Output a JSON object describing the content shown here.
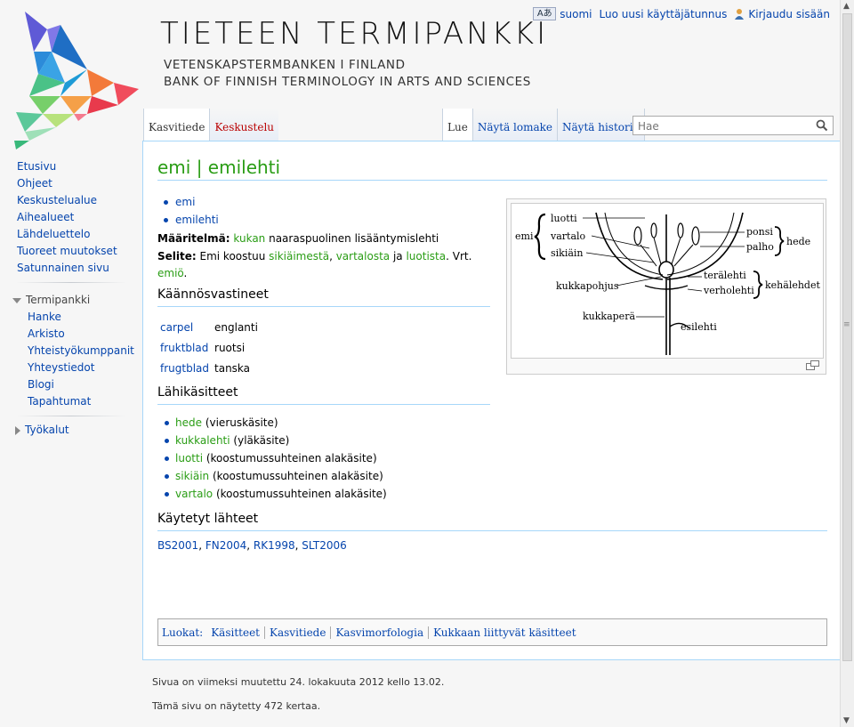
{
  "site": {
    "title": "TIETEEN TERMIPANKKI",
    "subtitle_sv": "VETENSKAPSTERMBANKEN I FINLAND",
    "subtitle_en": "BANK OF FINNISH TERMINOLOGY IN ARTS AND SCIENCES"
  },
  "personal": {
    "language": "suomi",
    "create_account": "Luo uusi käyttäjätunnus",
    "login": "Kirjaudu sisään"
  },
  "tabs": {
    "namespace": "Kasvitiede",
    "talk": "Keskustelu",
    "read": "Lue",
    "form": "Näytä lomake",
    "history": "Näytä historia"
  },
  "search": {
    "placeholder": "Hae"
  },
  "sidebar": {
    "nav": [
      "Etusivu",
      "Ohjeet",
      "Keskustelualue",
      "Aihealueet",
      "Lähdeluettelo",
      "Tuoreet muutokset",
      "Satunnainen sivu"
    ],
    "portal_title": "Termipankki",
    "portal": [
      "Hanke",
      "Arkisto",
      "Yhteistyökumppanit",
      "Yhteystiedot",
      "Blogi",
      "Tapahtumat"
    ],
    "tools": "Työkalut"
  },
  "page": {
    "heading": "emi | emilehti",
    "terms": [
      "emi",
      "emilehti"
    ],
    "def_label": "Määritelmä:",
    "def_link": "kukan",
    "def_text": " naaraspuolinen lisääntymislehti",
    "note_label": "Selite:",
    "note_t1": " Emi koostuu ",
    "note_l1": "sikiäimestä",
    "note_t2": ", ",
    "note_l2": "vartalosta",
    "note_t3": " ja ",
    "note_l3": "luotista",
    "note_t4": ". Vrt. ",
    "note_l4": "emiö",
    "note_t5": ".",
    "translations_heading": "Käännösvastineet",
    "translations": [
      {
        "term": "carpel",
        "lang": "englanti"
      },
      {
        "term": "fruktblad",
        "lang": "ruotsi"
      },
      {
        "term": "frugtblad",
        "lang": "tanska"
      }
    ],
    "related_heading": "Lähikäsitteet",
    "related": [
      {
        "term": "hede",
        "rel": " (vieruskäsite)"
      },
      {
        "term": "kukkalehti",
        "rel": " (yläkäsite)"
      },
      {
        "term": "luotti",
        "rel": " (koostumussuhteinen alakäsite)"
      },
      {
        "term": "sikiäin",
        "rel": " (koostumussuhteinen alakäsite)"
      },
      {
        "term": "vartalo",
        "rel": " (koostumussuhteinen alakäsite)"
      }
    ],
    "sources_heading": "Käytetyt lähteet",
    "sources": [
      "BS2001",
      "FN2004",
      "RK1998",
      "SLT2006"
    ],
    "figure_labels": {
      "emi": "emi",
      "luotti": "luotti",
      "vartalo": "vartalo",
      "sikiain": "sikiäin",
      "ponsi": "ponsi",
      "palho": "palho",
      "hede": "hede",
      "teralehti": "terälehti",
      "verholehti": "verholehti",
      "kehalehdet": "kehälehdet",
      "kukkapohjus": "kukkapohjus",
      "kukkapera": "kukkaperä",
      "esilehti": "esilehti"
    }
  },
  "categories": {
    "label": "Luokat:",
    "items": [
      "Käsitteet",
      "Kasvitiede",
      "Kasvimorfologia",
      "Kukkaan liittyvät käsitteet"
    ]
  },
  "footer": {
    "modified": "Sivua on viimeksi muutettu 24. lokakuuta 2012 kello 13.02.",
    "views": "Tämä sivu on näytetty 472 kertaa."
  },
  "colors": {
    "link": "#0645ad",
    "term_link": "#2a9d15",
    "border": "#a7d7f9",
    "new_link": "#ba0000"
  }
}
